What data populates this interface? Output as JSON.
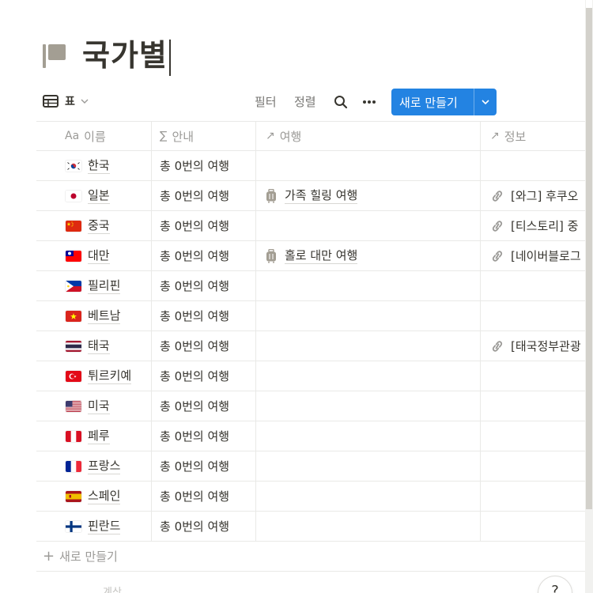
{
  "page": {
    "title": "국가별"
  },
  "toolbar": {
    "view_label": "표",
    "filter_label": "필터",
    "sort_label": "정렬",
    "search_icon": "search-icon",
    "more_icon": "more-horizontal-icon",
    "new_label": "새로 만들기",
    "accent": "#2383e2"
  },
  "table": {
    "columns": [
      {
        "icon": "Aa",
        "label": "이름"
      },
      {
        "icon": "∑",
        "label": "안내"
      },
      {
        "icon": "↗",
        "label": "여행"
      },
      {
        "icon": "↗",
        "label": "정보"
      }
    ],
    "rows": [
      {
        "flag": "kr-flag",
        "name": "한국",
        "guide": "총 0번의 여행",
        "trip": "",
        "info": ""
      },
      {
        "flag": "jp-flag",
        "name": "일본",
        "guide": "총 0번의 여행",
        "trip": "가족 힐링 여행",
        "info": "[와그] 후쿠오"
      },
      {
        "flag": "cn-flag",
        "name": "중국",
        "guide": "총 0번의 여행",
        "trip": "",
        "info": "[티스토리] 중"
      },
      {
        "flag": "tw-flag",
        "name": "대만",
        "guide": "총 0번의 여행",
        "trip": "홀로 대만 여행",
        "info": "[네이버블로그"
      },
      {
        "flag": "ph-flag",
        "name": "필리핀",
        "guide": "총 0번의 여행",
        "trip": "",
        "info": ""
      },
      {
        "flag": "vn-flag",
        "name": "베트남",
        "guide": "총 0번의 여행",
        "trip": "",
        "info": ""
      },
      {
        "flag": "th-flag",
        "name": "태국",
        "guide": "총 0번의 여행",
        "trip": "",
        "info": "[태국정부관광"
      },
      {
        "flag": "tr-flag",
        "name": "튀르키예",
        "guide": "총 0번의 여행",
        "trip": "",
        "info": ""
      },
      {
        "flag": "us-flag",
        "name": "미국",
        "guide": "총 0번의 여행",
        "trip": "",
        "info": ""
      },
      {
        "flag": "pe-flag",
        "name": "페루",
        "guide": "총 0번의 여행",
        "trip": "",
        "info": ""
      },
      {
        "flag": "fr-flag",
        "name": "프랑스",
        "guide": "총 0번의 여행",
        "trip": "",
        "info": ""
      },
      {
        "flag": "es-flag",
        "name": "스페인",
        "guide": "총 0번의 여행",
        "trip": "",
        "info": ""
      },
      {
        "flag": "fi-flag",
        "name": "핀란드",
        "guide": "총 0번의 여행",
        "trip": "",
        "info": ""
      }
    ],
    "new_row_label": "새로 만들기",
    "calc_label": "계산"
  },
  "help": {
    "label": "?"
  }
}
